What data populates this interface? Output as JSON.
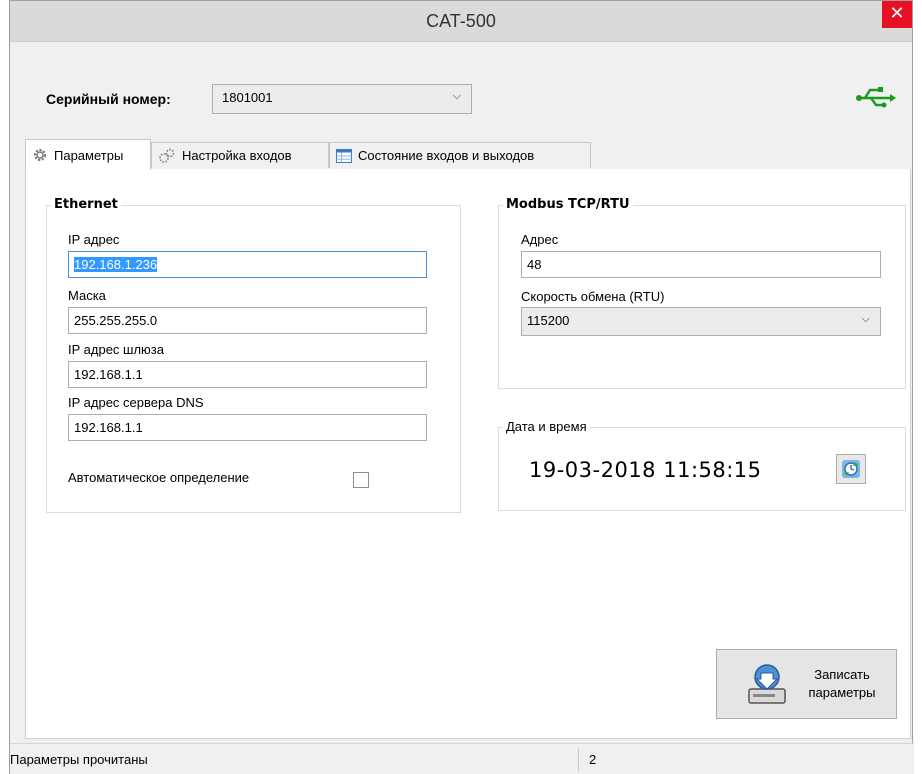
{
  "window": {
    "title": "CAT-500",
    "close_glyph": "✕"
  },
  "header": {
    "serial_label": "Серийный номер:",
    "serial_value": "1801001",
    "usb_icon": "usb-icon",
    "usb_color": "#1a9a1a"
  },
  "tabs": [
    {
      "label": "Параметры",
      "icon": "gear-icon",
      "active": true
    },
    {
      "label": "Настройка входов",
      "icon": "gears-icon",
      "active": false
    },
    {
      "label": "Состояние входов и выходов",
      "icon": "table-icon",
      "active": false
    }
  ],
  "ethernet": {
    "title": "Ethernet",
    "ip_label": "IP адрес",
    "ip_value": "192.168.1.236",
    "mask_label": "Маска",
    "mask_value": "255.255.255.0",
    "gateway_label": "IP адрес шлюза",
    "gateway_value": "192.168.1.1",
    "dns_label": "IP адрес сервера DNS",
    "dns_value": "192.168.1.1",
    "auto_label": "Автоматическое определение",
    "auto_checked": false
  },
  "modbus": {
    "title": "Modbus TCP/RTU",
    "address_label": "Адрес",
    "address_value": "48",
    "speed_label": "Скорость обмена (RTU)",
    "speed_value": "115200"
  },
  "datetime": {
    "title": "Дата и время",
    "value": "19-03-2018 11:58:15",
    "sync_icon": "clock-sync-icon"
  },
  "actions": {
    "write_label_line1": "Записать",
    "write_label_line2": "параметры",
    "write_icon": "save-device-icon"
  },
  "status": {
    "message": "Параметры прочитаны",
    "count": "2"
  }
}
